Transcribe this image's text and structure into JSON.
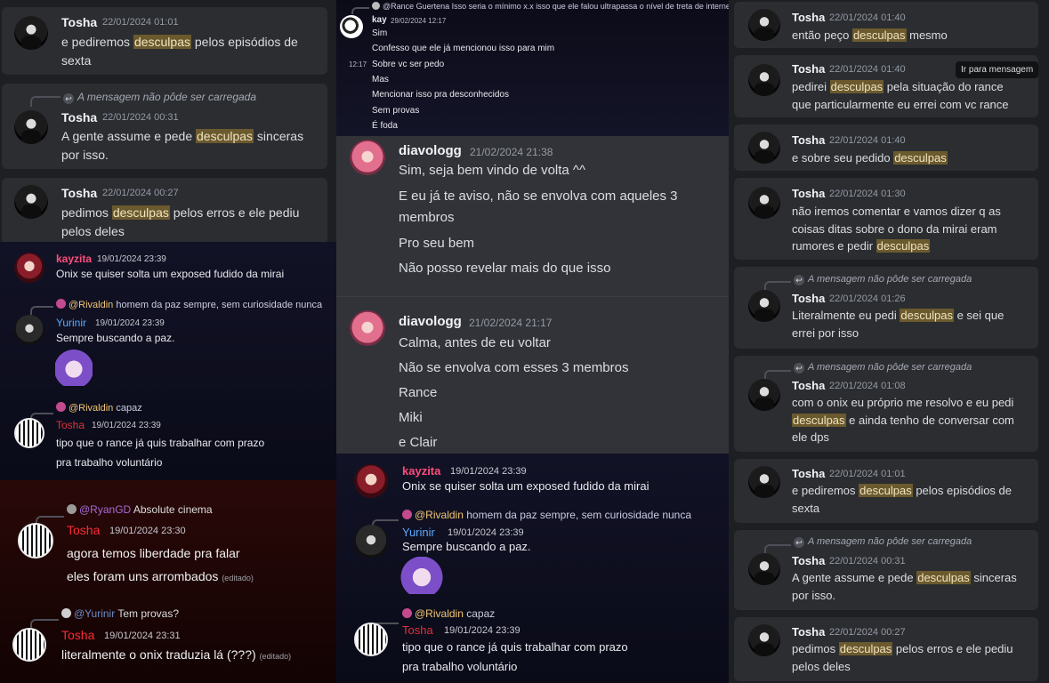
{
  "left": {
    "top_msgs": [
      {
        "name": "Tosha",
        "ts": "22/01/2024 01:01",
        "l1a": "e pediremos ",
        "hl": "desculpas",
        "l1b": " pelos episódios de",
        "l2": "sexta"
      },
      {
        "reply": "A mensagem não pôde ser carregada",
        "name": "Tosha",
        "ts": "22/01/2024 00:31",
        "l1a": "A gente assume e pede ",
        "hl": "desculpas",
        "l1b": " sinceras",
        "l2": "por isso."
      },
      {
        "name": "Tosha",
        "ts": "22/01/2024 00:27",
        "l1a": "pedimos ",
        "hl": "desculpas",
        "l1b": " pelos erros e ele pediu",
        "l2": "pelos deles"
      }
    ],
    "navy": {
      "m1": {
        "name": "kayzita",
        "ts": "19/01/2024 23:39",
        "text": "Onix se quiser solta um exposed fudido da mirai"
      },
      "m2": {
        "reply_user": "@Rivaldin",
        "reply_text": "homem da paz sempre, sem curiosidade nunca",
        "name": "Yurinir",
        "ts": "19/01/2024 23:39",
        "text": "Sempre buscando a paz."
      },
      "m3": {
        "reply_user": "@Rivaldin",
        "reply_text": "capaz",
        "name": "Tosha",
        "ts": "19/01/2024 23:39",
        "l1": "tipo que o rance já quis trabalhar com prazo",
        "l2": "pra trabalho voluntário"
      }
    },
    "red": {
      "m1": {
        "reply_user": "@RyanGD",
        "reply_text": "Absolute cinema",
        "name": "Tosha",
        "ts": "19/01/2024 23:30",
        "l1": "agora temos liberdade pra falar",
        "l2": "eles foram uns arrombados",
        "edited": "(editado)"
      },
      "m2": {
        "reply_user": "@Yurinir",
        "reply_text": "Tem provas?",
        "name": "Tosha",
        "ts": "19/01/2024 23:31",
        "text": "literalmente o onix traduzia lá (???)",
        "edited": "(editado)"
      }
    }
  },
  "middle": {
    "top": {
      "reply_text": "@Rance Guertena Isso seria o mínimo x.x isso que ele falou ultrapassa o nível de treta de internet",
      "name": "kay",
      "ts": "29/02/2024 12:17",
      "time": "12:17",
      "lines": [
        "Sim",
        "Confesso que ele já mencionou isso para mim",
        "Sobre vc ser pedo",
        "Mas",
        "Mencionar isso pra desconhecidos",
        "Sem provas",
        "É foda"
      ]
    },
    "d1": {
      "name": "diavologg",
      "ts": "21/02/2024 21:38",
      "lines": [
        "Sim, seja bem vindo de volta ^^",
        "E eu já te aviso, não se envolva com aqueles 3",
        "membros",
        "Pro seu bem",
        "Não posso revelar mais do que isso"
      ]
    },
    "d2": {
      "name": "diavologg",
      "ts": "21/02/2024 21:17",
      "lines": [
        "Calma, antes de eu voltar",
        "Não se envolva com esses 3 membros",
        "Rance",
        "Miki",
        "e Clair"
      ]
    },
    "navy": {
      "m1": {
        "name": "kayzita",
        "ts": "19/01/2024 23:39",
        "text": "Onix se quiser solta um exposed fudido da mirai"
      },
      "m2": {
        "reply_user": "@Rivaldin",
        "reply_text": "homem da paz sempre, sem curiosidade nunca",
        "name": "Yurinir",
        "ts": "19/01/2024 23:39",
        "text": "Sempre buscando a paz."
      },
      "m3": {
        "reply_user": "@Rivaldin",
        "reply_text": "capaz",
        "name": "Tosha",
        "ts": "19/01/2024 23:39",
        "l1": "tipo que o rance já quis trabalhar com prazo",
        "l2": "pra trabalho voluntário"
      }
    }
  },
  "right": {
    "tooltip": "Ir para mensagem",
    "reply_missing": "A mensagem não pôde ser carregada",
    "m1": {
      "name": "Tosha",
      "ts": "22/01/2024 01:40",
      "a": "então peço ",
      "hl": "desculpas",
      "b": " mesmo"
    },
    "m2": {
      "name": "Tosha",
      "ts": "22/01/2024 01:40",
      "a": "pedirei ",
      "hl": "desculpas",
      "b": " pela situação do rance",
      "l2": "que particularmente eu errei com vc rance"
    },
    "m3": {
      "name": "Tosha",
      "ts": "22/01/2024 01:40",
      "a": "e sobre seu pedido ",
      "hl": "desculpas"
    },
    "m4": {
      "name": "Tosha",
      "ts": "22/01/2024 01:30",
      "l1": "não iremos comentar e vamos dizer q as",
      "l2": "coisas ditas sobre o dono da mirai eram",
      "a": "rumores e pedir ",
      "hl": "desculpas"
    },
    "m5": {
      "name": "Tosha",
      "ts": "22/01/2024 01:26",
      "a": "Literalmente eu pedi ",
      "hl": "desculpas",
      "b": " e sei que",
      "l2": "errei por isso"
    },
    "m6": {
      "name": "Tosha",
      "ts": "22/01/2024 01:08",
      "l1": "com o onix eu próprio me resolvo e eu pedi",
      "hl": "desculpas",
      "b": " e ainda tenho de conversar com",
      "l3": "ele dps"
    },
    "m7": {
      "name": "Tosha",
      "ts": "22/01/2024 01:01",
      "a": "e pediremos ",
      "hl": "desculpas",
      "b": " pelos episódios de",
      "l2": "sexta"
    },
    "m8": {
      "name": "Tosha",
      "ts": "22/01/2024 00:31",
      "a": "A gente assume e pede ",
      "hl": "desculpas",
      "b": " sinceras",
      "l2": "por isso."
    },
    "m9": {
      "name": "Tosha",
      "ts": "22/01/2024 00:27",
      "a": "pedimos ",
      "hl": "desculpas",
      "b": " pelos erros e ele pediu",
      "l2": "pelos deles"
    }
  }
}
